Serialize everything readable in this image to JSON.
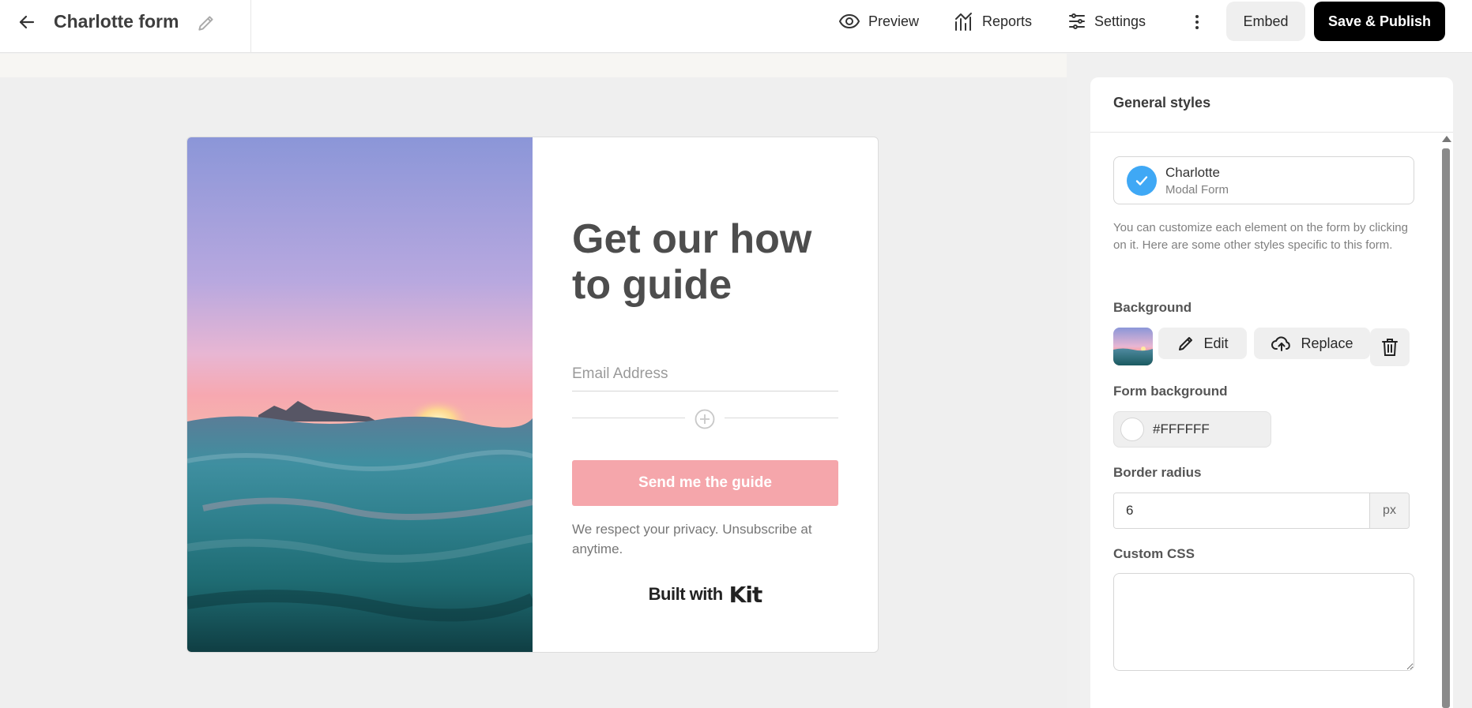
{
  "header": {
    "back_icon": "arrow-left-icon",
    "form_title": "Charlotte form",
    "edit_icon": "pencil-icon",
    "nav": [
      {
        "label": "Preview",
        "icon": "eye-icon"
      },
      {
        "label": "Reports",
        "icon": "chart-icon"
      },
      {
        "label": "Settings",
        "icon": "sliders-icon"
      }
    ],
    "more_icon": "kebab-icon",
    "embed_label": "Embed",
    "publish_label": "Save & Publish"
  },
  "form": {
    "headline": "Get our how to guide",
    "email_placeholder": "Email Address",
    "add_field_icon": "plus-circle-icon",
    "button_label": "Send me the guide",
    "button_color": "#f5a6ab",
    "privacy": "We respect your privacy. Unsubscribe at anytime.",
    "built_with": "Built with",
    "brand": "Kit"
  },
  "panel": {
    "title": "General styles",
    "selected_form": {
      "name": "Charlotte",
      "type": "Modal Form"
    },
    "help_text": "You can customize each element on the form by clicking on it. Here are some other styles specific to this form.",
    "background": {
      "label": "Background",
      "edit_label": "Edit",
      "replace_label": "Replace"
    },
    "form_background": {
      "label": "Form background",
      "value": "#FFFFFF"
    },
    "border_radius": {
      "label": "Border radius",
      "value": "6",
      "unit": "px"
    },
    "custom_css": {
      "label": "Custom CSS",
      "value": ""
    }
  }
}
